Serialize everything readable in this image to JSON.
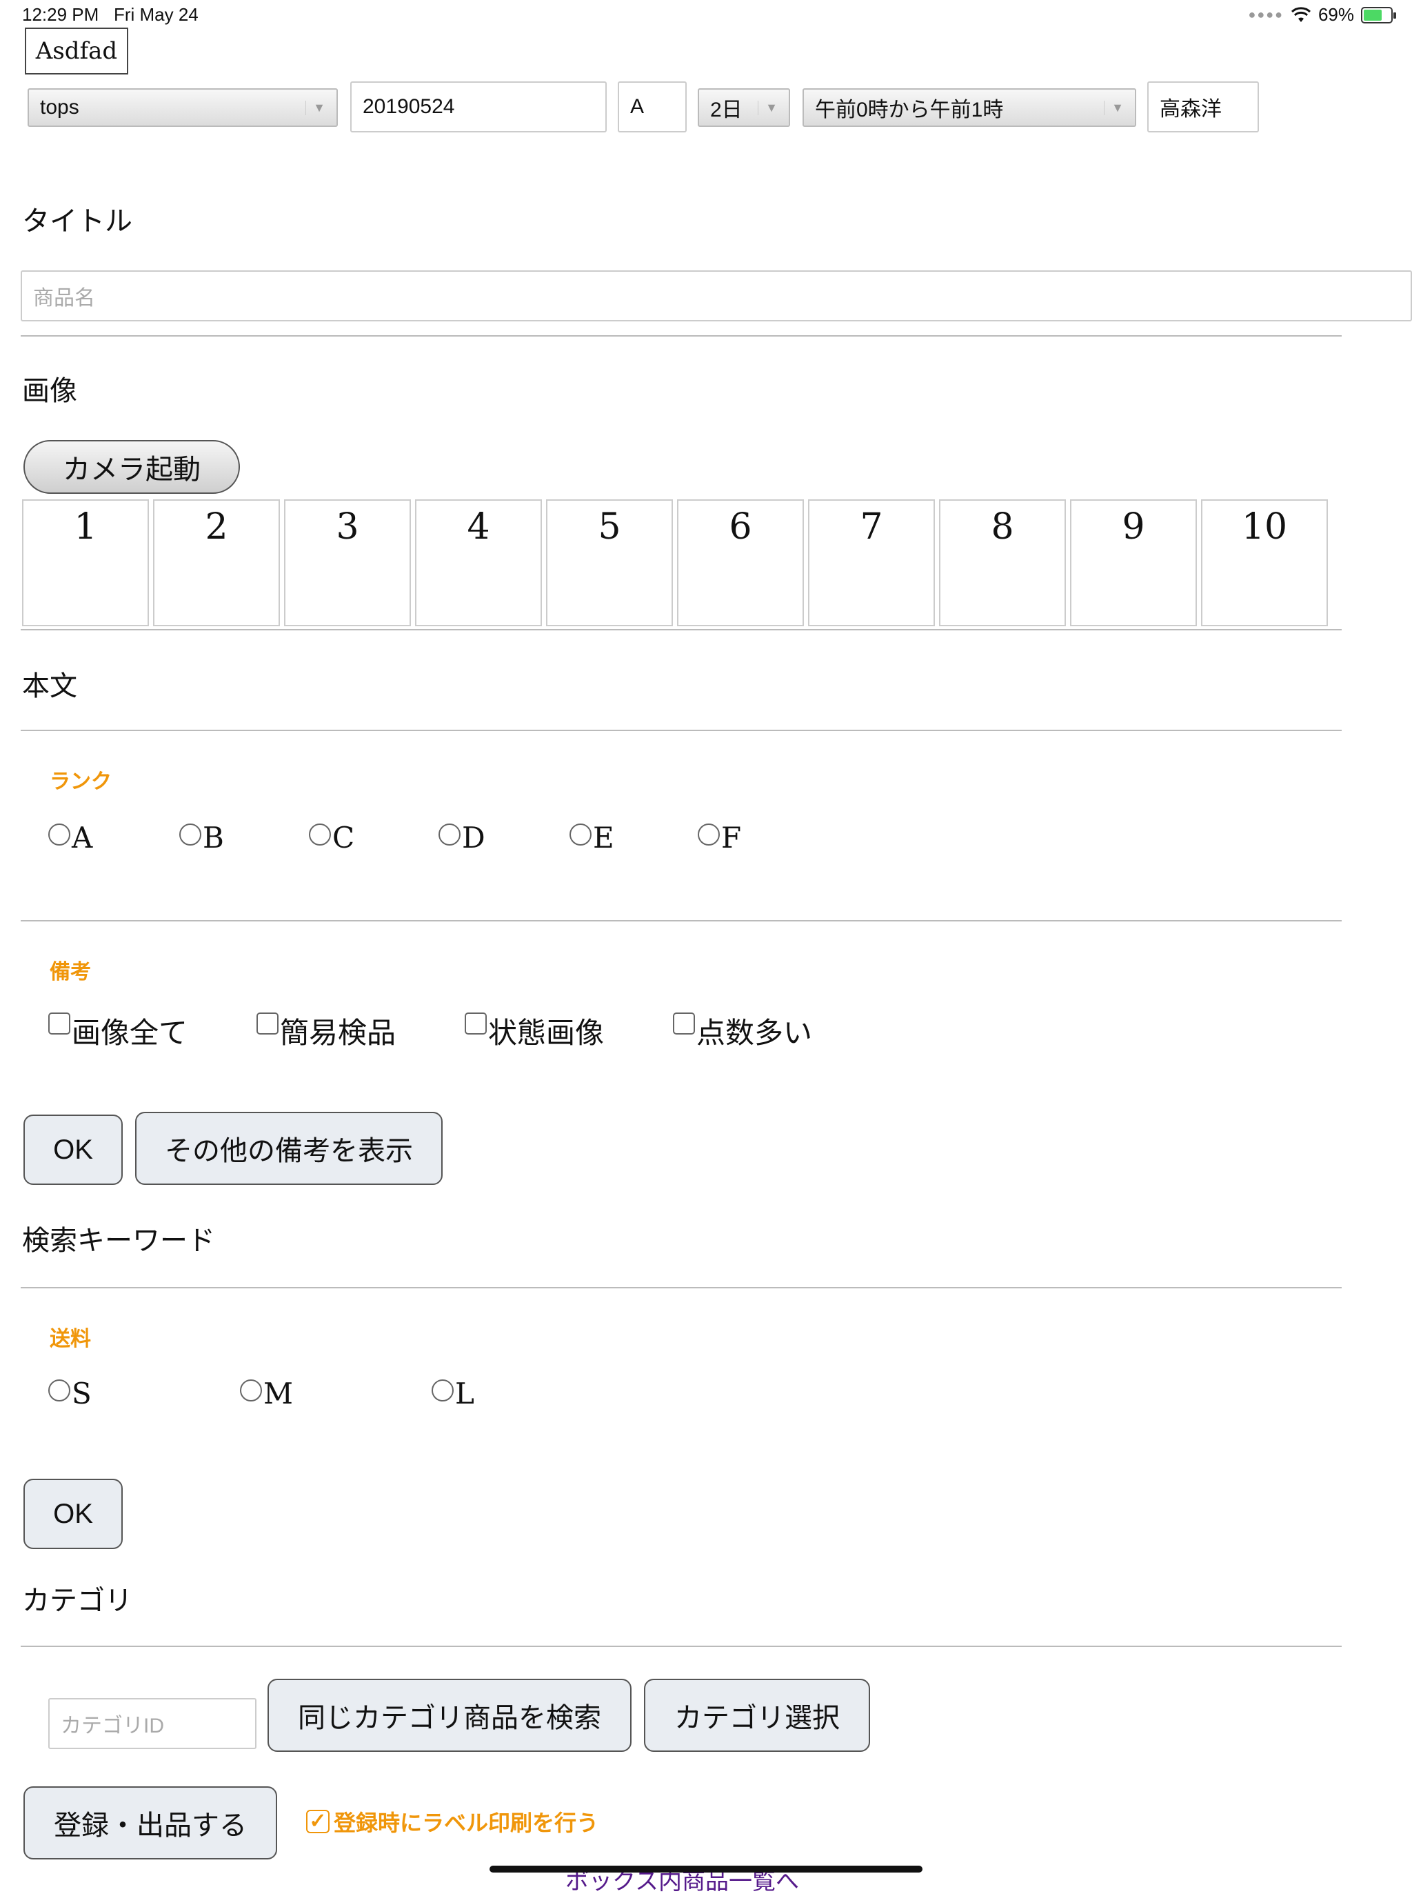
{
  "status": {
    "time": "12:29 PM",
    "date": "Fri May 24",
    "battery": "69%"
  },
  "header": {
    "name": "Asdfad",
    "category_select": "tops",
    "date_field": "20190524",
    "letter_field": "A",
    "day_select": "2日",
    "time_select": "午前0時から午前1時",
    "person_field": "高森洋"
  },
  "title_section": {
    "label": "タイトル",
    "placeholder": "商品名"
  },
  "image_section": {
    "label": "画像",
    "camera_button": "カメラ起動",
    "slots": [
      "1",
      "2",
      "3",
      "4",
      "5",
      "6",
      "7",
      "8",
      "9",
      "10"
    ]
  },
  "body_section": {
    "label": "本文"
  },
  "rank": {
    "title": "ランク",
    "options": [
      "A",
      "B",
      "C",
      "D",
      "E",
      "F"
    ]
  },
  "notes": {
    "title": "備考",
    "options": [
      "画像全て",
      "簡易検品",
      "状態画像",
      "点数多い"
    ],
    "ok_button": "OK",
    "more_button": "その他の備考を表示"
  },
  "keywords": {
    "label": "検索キーワード"
  },
  "shipping": {
    "title": "送料",
    "options": [
      "S",
      "M",
      "L"
    ],
    "ok_button": "OK"
  },
  "category": {
    "label": "カテゴリ",
    "id_placeholder": "カテゴリID",
    "search_button": "同じカテゴリ商品を検索",
    "select_button": "カテゴリ選択"
  },
  "footer": {
    "submit_button": "登録・出品する",
    "print_label": "登録時にラベル印刷を行う",
    "link": "ボックス内商品一覧へ"
  }
}
